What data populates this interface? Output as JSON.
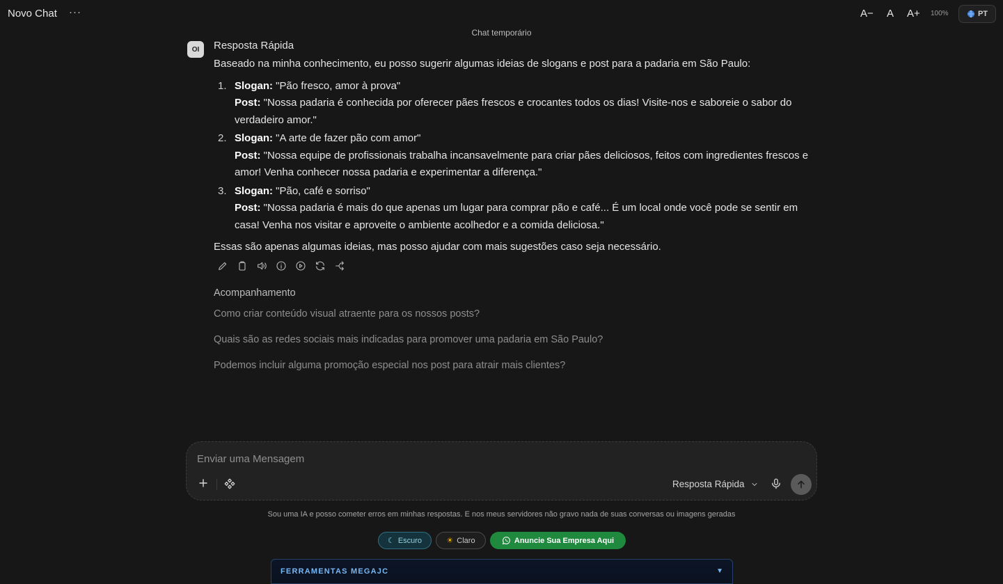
{
  "header": {
    "title": "Novo Chat",
    "menu_glyph": "···",
    "font_decrease": "A−",
    "font_reset": "A",
    "font_increase": "A+",
    "zoom": "100%",
    "language": "PT",
    "temp_label": "Chat temporário"
  },
  "message": {
    "avatar": "OI",
    "model": "Resposta Rápida",
    "intro": "Baseado na minha conhecimento, eu posso sugerir algumas ideias de slogans e post para a padaria em São Paulo:",
    "slogan_label": "Slogan:",
    "post_label": "Post:",
    "items": [
      {
        "num": "1.",
        "slogan": " \"Pão fresco, amor à prova\"",
        "post": " \"Nossa padaria é conhecida por oferecer pães frescos e crocantes todos os dias! Visite-nos e saboreie o sabor do verdadeiro amor.\""
      },
      {
        "num": "2.",
        "slogan": " \"A arte de fazer pão com amor\"",
        "post": " \"Nossa equipe de profissionais trabalha incansavelmente para criar pães deliciosos, feitos com ingredientes frescos e amor! Venha conhecer nossa padaria e experimentar a diferença.\""
      },
      {
        "num": "3.",
        "slogan": " \"Pão, café e sorriso\"",
        "post": " \"Nossa padaria é mais do que apenas um lugar para comprar pão e café... É um local onde você pode se sentir em casa! Venha nos visitar e aproveite o ambiente acolhedor e a comida deliciosa.\""
      }
    ],
    "outro": "Essas são apenas algumas ideias, mas posso ajudar com mais sugestões caso seja necessário.",
    "action_icons": [
      "edit-icon",
      "copy-icon",
      "speaker-icon",
      "info-icon",
      "play-icon",
      "regenerate-icon",
      "share-icon"
    ]
  },
  "followup": {
    "title": "Acompanhamento",
    "items": [
      "Como criar conteúdo visual atraente para os nossos posts?",
      "Quais são as redes sociais mais indicadas para promover uma padaria em São Paulo?",
      "Podemos incluir alguma promoção especial nos post para atrair mais clientes?"
    ]
  },
  "composer": {
    "placeholder": "Enviar uma Mensagem",
    "model_selected": "Resposta Rápida"
  },
  "footer": {
    "disclaimer": "Sou uma IA e posso cometer erros em minhas respostas. E nos meus servidores não gravo nada de suas conversas ou imagens geradas",
    "theme_dark": "Escuro",
    "theme_light": "Claro",
    "advertise": "Anuncie Sua Empresa Aqui",
    "tools_label": "FERRAMENTAS MEGAJC",
    "tools_arrow": "▼"
  },
  "colors": {
    "background": "#171717",
    "whatsapp_green": "#1f8a3e",
    "tools_accent": "#78b6f2",
    "dark_pill_accent": "#8fd3e6"
  }
}
